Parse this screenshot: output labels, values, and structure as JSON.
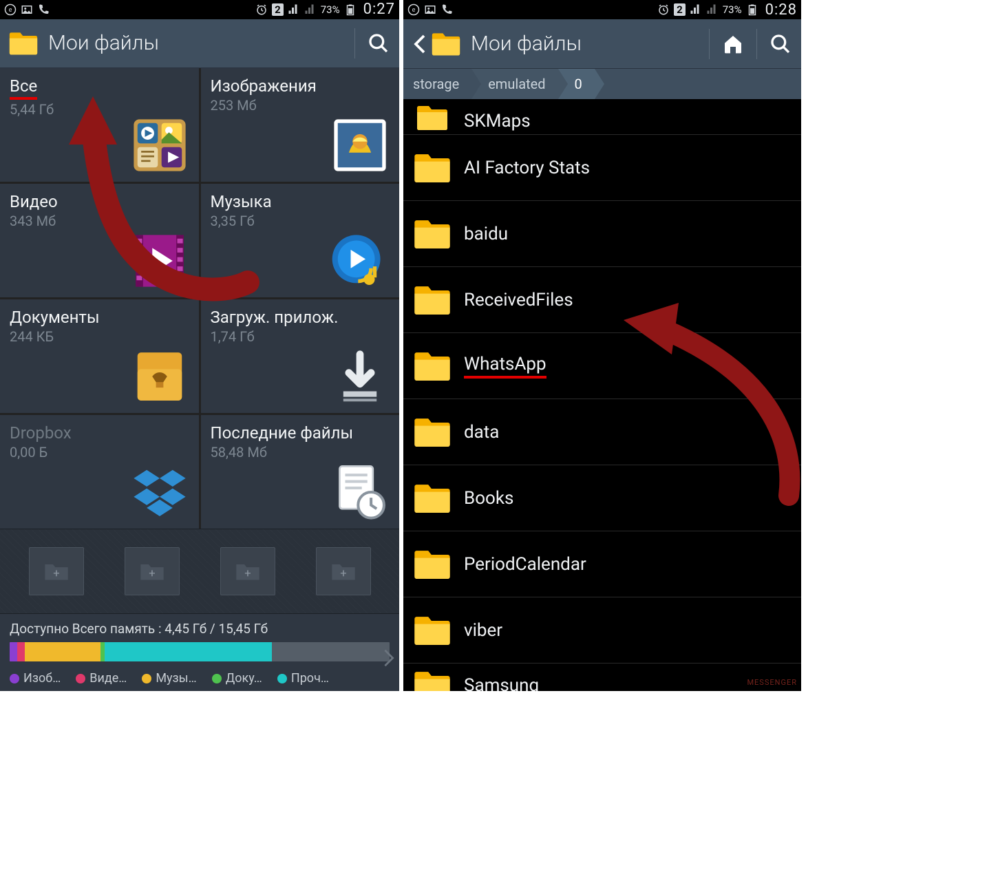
{
  "left": {
    "status": {
      "battery_pct": "73%",
      "time": "0:27",
      "sim": "2"
    },
    "title": "Мои файлы",
    "tiles": [
      {
        "title": "Все",
        "size": "5,44 Гб"
      },
      {
        "title": "Изображения",
        "size": "253 Мб"
      },
      {
        "title": "Видео",
        "size": "343 Мб"
      },
      {
        "title": "Музыка",
        "size": "3,35 Гб"
      },
      {
        "title": "Документы",
        "size": "244 КБ"
      },
      {
        "title": "Загруж. прилож.",
        "size": "1,74 Гб"
      },
      {
        "title": "Dropbox",
        "size": "0,00 Б"
      },
      {
        "title": "Последние файлы",
        "size": "58,48 Мб"
      }
    ],
    "storage_label": "Доступно Всего память : 4,45 Гб / 15,45 Гб",
    "legend": [
      "Изоб…",
      "Виде…",
      "Музы…",
      "Доку…",
      "Проч…"
    ],
    "legend_colors": [
      "#8a3fd1",
      "#e0396b",
      "#f0b92c",
      "#4fc24f",
      "#1fc7c7"
    ]
  },
  "right": {
    "status": {
      "battery_pct": "73%",
      "time": "0:28",
      "sim": "2"
    },
    "title": "Мои файлы",
    "crumbs": [
      "storage",
      "emulated",
      "0"
    ],
    "folders": [
      "SKMaps",
      "AI Factory Stats",
      "baidu",
      "ReceivedFiles",
      "WhatsApp",
      "data",
      "Books",
      "PeriodCalendar",
      "viber",
      "Samsung"
    ],
    "highlighted_folder": "WhatsApp",
    "watermark": "MESSENGER"
  }
}
